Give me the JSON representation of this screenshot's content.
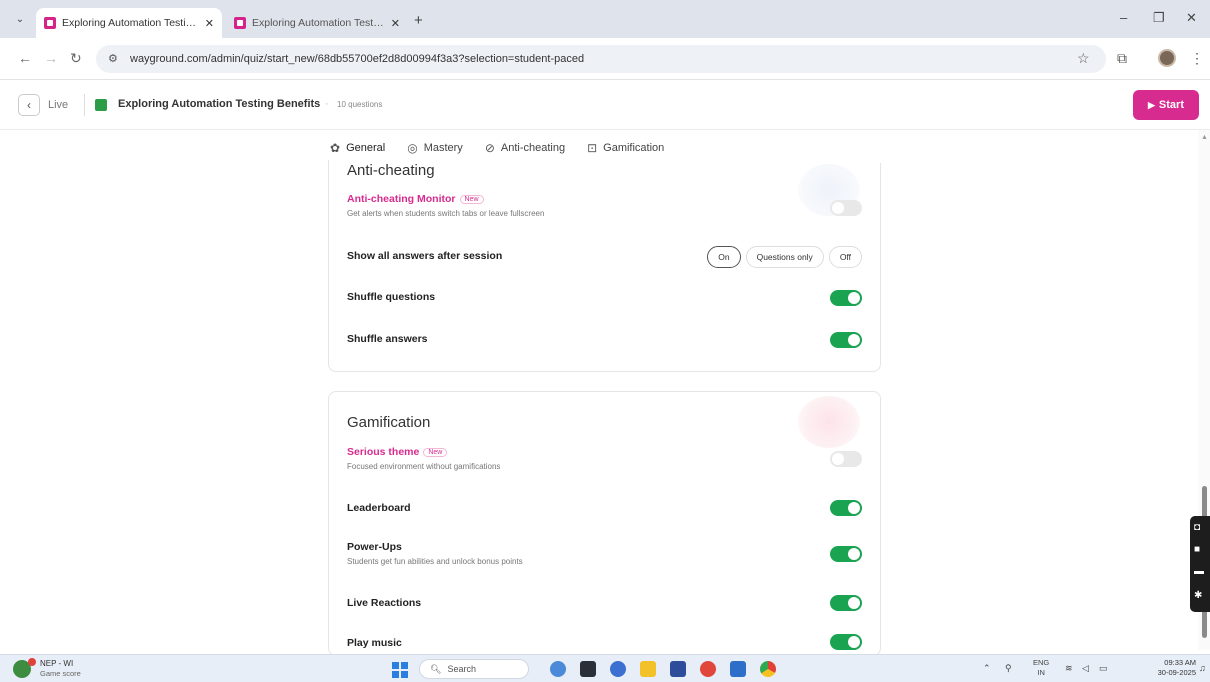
{
  "browser": {
    "tabs": [
      {
        "title": "Exploring Automation Testing I",
        "close": "✕",
        "active": true
      },
      {
        "title": "Exploring Automation Testing I",
        "close": "✕",
        "active": false
      }
    ],
    "new_tab": "+",
    "url": "wayground.com/admin/quiz/start_new/68db55700ef2d8d00994f3a3?selection=student-paced",
    "window_controls": {
      "minimize": "–",
      "restore": "❐",
      "close": "✕"
    }
  },
  "header": {
    "back_label": "Live",
    "quiz_title": "Exploring Automation Testing Benefits",
    "separator": "·",
    "question_count": "10 questions",
    "start_label": "Start"
  },
  "settings_tabs": [
    {
      "label": "General",
      "icon": "gear-icon",
      "glyph": "✿"
    },
    {
      "label": "Mastery",
      "icon": "mastery-icon",
      "glyph": "◎"
    },
    {
      "label": "Anti-cheating",
      "icon": "shield-check-icon",
      "glyph": "⊘"
    },
    {
      "label": "Gamification",
      "icon": "gamepad-icon",
      "glyph": "⊡"
    }
  ],
  "anti_cheating": {
    "title": "Anti-cheating",
    "monitor": {
      "label": "Anti-cheating Monitor",
      "badge": "New",
      "desc": "Get alerts when students switch tabs or leave fullscreen",
      "enabled": false
    },
    "show_answers": {
      "label": "Show all answers after session",
      "options": [
        "On",
        "Questions only",
        "Off"
      ],
      "selected": "On"
    },
    "shuffle_questions": {
      "label": "Shuffle questions",
      "enabled": true
    },
    "shuffle_answers": {
      "label": "Shuffle answers",
      "enabled": true
    }
  },
  "gamification": {
    "title": "Gamification",
    "serious_theme": {
      "label": "Serious theme",
      "badge": "New",
      "desc": "Focused environment without gamifications",
      "enabled": false
    },
    "leaderboard": {
      "label": "Leaderboard",
      "enabled": true
    },
    "power_ups": {
      "label": "Power-Ups",
      "desc": "Students get fun abilities and unlock bonus points",
      "enabled": true
    },
    "live_reactions": {
      "label": "Live Reactions",
      "enabled": true
    },
    "play_music": {
      "label": "Play music",
      "enabled": true
    }
  },
  "taskbar": {
    "weather_line1": "NEP - WI",
    "weather_line2": "Game score",
    "search_placeholder": "Search",
    "lang_line1": "ENG",
    "lang_line2": "IN",
    "time": "09:33 AM",
    "date": "30-09-2025"
  },
  "colors": {
    "accent": "#d82b8f",
    "toggle_on": "#1aa351",
    "toggle_off": "#e8e8e8"
  }
}
